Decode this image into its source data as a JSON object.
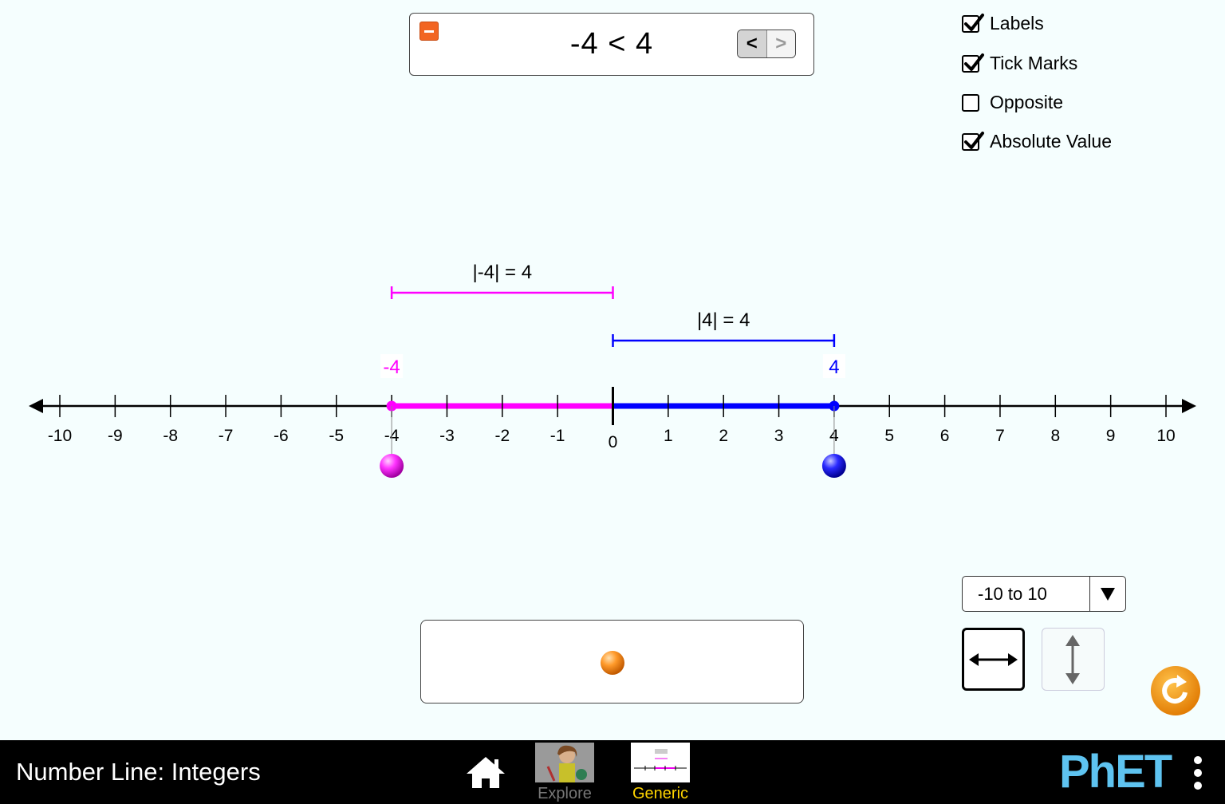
{
  "comparison": {
    "statement": "-4 < 4",
    "less_than_label": "<",
    "greater_than_label": ">",
    "selected_operator": "<"
  },
  "checkboxes": [
    {
      "label": "Labels",
      "checked": true
    },
    {
      "label": "Tick Marks",
      "checked": true
    },
    {
      "label": "Opposite",
      "checked": false
    },
    {
      "label": "Absolute Value",
      "checked": true
    }
  ],
  "number_line": {
    "min": -10,
    "max": 10,
    "tick_labels": [
      "-10",
      "-9",
      "-8",
      "-7",
      "-6",
      "-5",
      "-4",
      "-3",
      "-2",
      "-1",
      "0",
      "1",
      "2",
      "3",
      "4",
      "5",
      "6",
      "7",
      "8",
      "9",
      "10"
    ],
    "points": [
      {
        "value": -4,
        "label": "-4",
        "color": "#ff00ff",
        "abs_label": "|-4| = 4"
      },
      {
        "value": 4,
        "label": "4",
        "color": "#0000ff",
        "abs_label": "|4| = 4"
      }
    ]
  },
  "range_select": {
    "selected": "-10 to 10"
  },
  "orientation": {
    "selected": "horizontal"
  },
  "colors": {
    "magenta": "#ff00ff",
    "blue": "#0000ff",
    "orange": "#f26522",
    "background": "#f5fefe"
  },
  "navbar": {
    "title": "Number Line: Integers",
    "tabs": [
      {
        "label": "Explore",
        "selected": false
      },
      {
        "label": "Generic",
        "selected": true
      }
    ],
    "logo": "PhET"
  }
}
